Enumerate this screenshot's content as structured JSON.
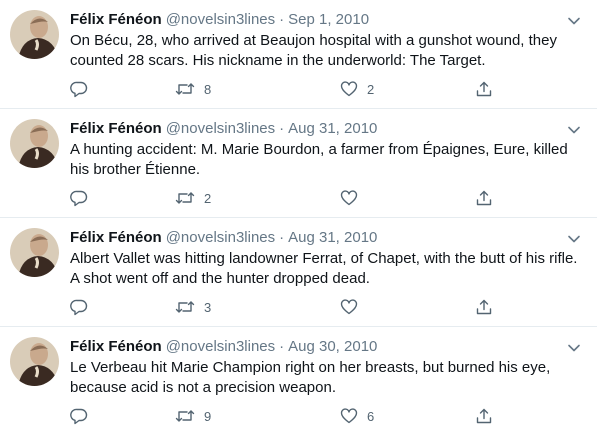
{
  "tweets": [
    {
      "name": "Félix Fénéon",
      "handle": "@novelsin3lines",
      "separator": "·",
      "date": "Sep 1, 2010",
      "text": "On Bécu, 28, who arrived at Beaujon hospital with a gunshot wound, they counted 28 scars. His nickname in the underworld: The Target.",
      "retweets": "8",
      "likes": "2"
    },
    {
      "name": "Félix Fénéon",
      "handle": "@novelsin3lines",
      "separator": "·",
      "date": "Aug 31, 2010",
      "text": "A hunting accident: M. Marie Bourdon, a farmer from Épaignes, Eure, killed his brother Étienne.",
      "retweets": "2",
      "likes": ""
    },
    {
      "name": "Félix Fénéon",
      "handle": "@novelsin3lines",
      "separator": "·",
      "date": "Aug 31, 2010",
      "text": "Albert Vallet was hitting landowner Ferrat, of Chapet, with the butt of his rifle. A shot went off and the hunter dropped dead.",
      "retweets": "3",
      "likes": ""
    },
    {
      "name": "Félix Fénéon",
      "handle": "@novelsin3lines",
      "separator": "·",
      "date": "Aug 30, 2010",
      "text": "Le Verbeau hit Marie Champion right on her breasts, but burned his eye, because acid is not a precision weapon.",
      "retweets": "9",
      "likes": "6"
    }
  ],
  "icons": {
    "avatar": "portrait-avatar",
    "caret": "chevron-down-icon",
    "reply": "reply-icon",
    "retweet": "retweet-icon",
    "like": "heart-icon",
    "share": "share-icon"
  },
  "colors": {
    "text": "#0f1419",
    "secondary": "#657786",
    "divider": "#e6ecf0"
  }
}
